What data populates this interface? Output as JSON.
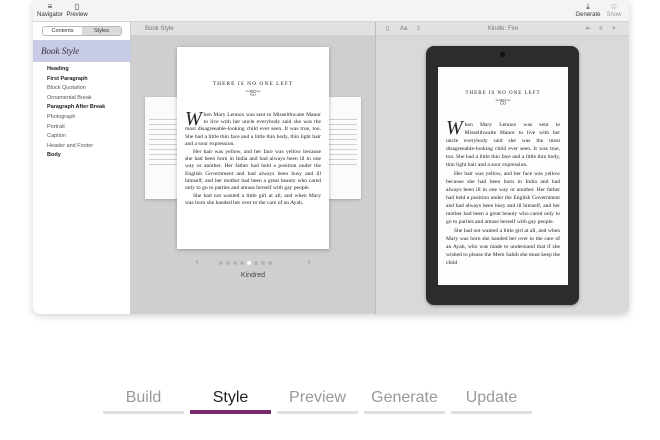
{
  "toolbar": {
    "navigator_label": "Navigator",
    "preview_label": "Preview",
    "generate_label": "Generate",
    "show_label": "Show"
  },
  "sidebar": {
    "segments": [
      "Contents",
      "Styles"
    ],
    "selected_style": "Book Style",
    "items": [
      {
        "label": "Heading",
        "bold": true
      },
      {
        "label": "First Paragraph",
        "bold": true
      },
      {
        "label": "Block Quotation",
        "bold": false
      },
      {
        "label": "Ornamental Break",
        "bold": false
      },
      {
        "label": "Paragraph After Break",
        "bold": true
      },
      {
        "label": "Photograph",
        "bold": false
      },
      {
        "label": "Portrait",
        "bold": false
      },
      {
        "label": "Caption",
        "bold": false
      },
      {
        "label": "Header and Footer",
        "bold": false
      },
      {
        "label": "Body",
        "bold": true
      }
    ]
  },
  "middle": {
    "header": "Book Style",
    "chapter_title": "THERE IS NO ONE LEFT",
    "ornament": "~ஐ~",
    "drop_cap": "W",
    "para1": "hen Mary Lennox was sent to Misselthwaite Manor to live with her uncle everybody said she was the most disagreeable-looking child ever seen. It was true, too. She had a little thin face and a little thin body, thin light hair and a sour expression.",
    "para2": "Her hair was yellow, and her face was yellow because she had been born in India and had always been ill in one way or another. Her father had held a position under the English Government and had always been busy and ill himself, and her mother had been a great beauty who cared only to go to parties and amuse herself with gay people.",
    "para3": "She had not wanted a little girl at all, and when Mary was born she handed her over to the care of an Ayah,",
    "theme_name": "Kindred",
    "page_count": 8,
    "current_page": 4
  },
  "right": {
    "header": "Kindle: Fire",
    "chapter_title": "THERE IS NO ONE LEFT",
    "ornament": "~ஐ~",
    "drop_cap": "W",
    "para1": "hen Mary Lennox was sent to Misselthwaite Manor to live with her uncle everybody said she was the most disagreeable-looking child ever seen. It was true, too. She had a little thin face and a little thin body, thin light hair and a sour expression.",
    "para2": "Her hair was yellow, and her face was yellow because she had been born in India and had always been ill in one way or another. Her father had held a position under the English Government and had always been busy and ill himself, and her mother had been a great beauty who cared only to go to parties and amuse herself with gay people.",
    "para3": "She had not wanted a little girl at all, and when Mary was born she handed her over to the care of an Ayah, who was made to understand that if she wished to please the Mem Sahib she must keep the child"
  },
  "bottom_tabs": [
    "Build",
    "Style",
    "Preview",
    "Generate",
    "Update"
  ],
  "active_tab": "Style",
  "colors": {
    "accent": "#7c2a6e",
    "selection": "#c7cbe6",
    "device": "#2c2c2c"
  }
}
